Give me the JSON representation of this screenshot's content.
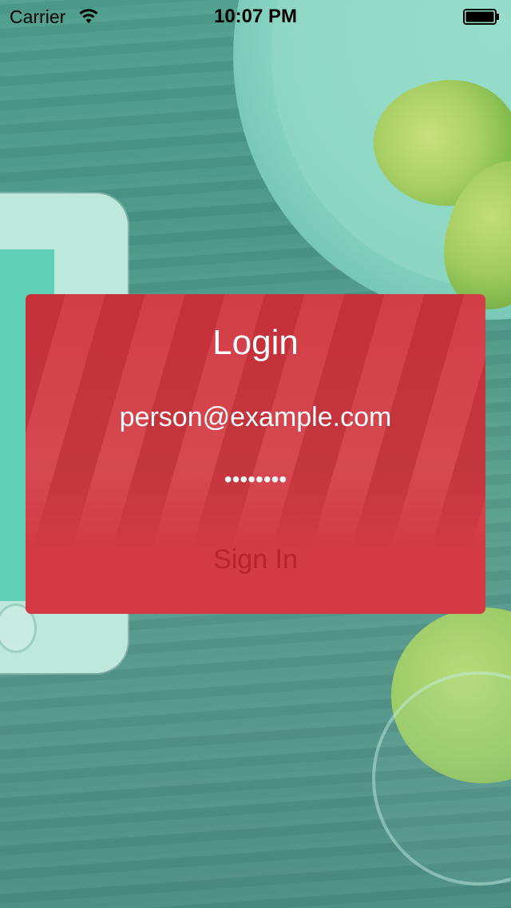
{
  "status_bar": {
    "carrier": "Carrier",
    "time": "10:07 PM",
    "wifi_icon": "wifi-icon",
    "battery_icon": "battery-icon"
  },
  "login": {
    "title": "Login",
    "email_value": "person@example.com",
    "password_value": "••••••••",
    "sign_in_label": "Sign In"
  },
  "colors": {
    "card": "#d33a43",
    "sign_in_text": "#b8232b",
    "background_tint": "#4e9f8c"
  }
}
